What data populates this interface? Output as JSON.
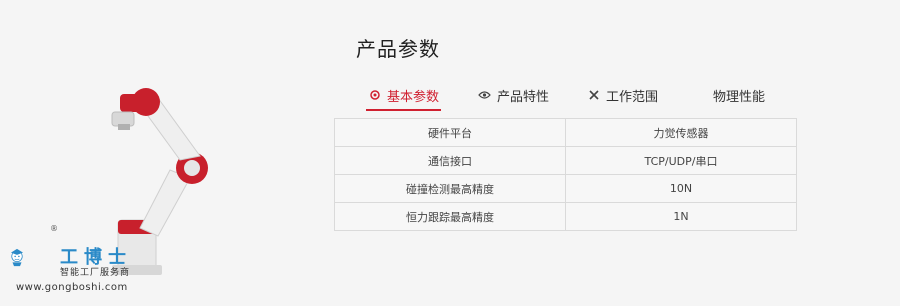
{
  "section": {
    "title": "产品参数"
  },
  "tabs": [
    {
      "label": "基本参数",
      "icon": "gear-icon",
      "active": true
    },
    {
      "label": "产品特性",
      "icon": "eye-icon",
      "active": false
    },
    {
      "label": "工作范围",
      "icon": "tools-icon",
      "active": false
    },
    {
      "label": "物理性能",
      "icon": "",
      "active": false
    }
  ],
  "table": {
    "rows": [
      {
        "name": "硬件平台",
        "value": "力觉传感器"
      },
      {
        "name": "通信接口",
        "value": "TCP/UDP/串口"
      },
      {
        "name": "碰撞检测最高精度",
        "value": "10N"
      },
      {
        "name": "恒力跟踪最高精度",
        "value": "1N"
      }
    ]
  },
  "watermark": {
    "brand": "工博士",
    "tagline": "智能工厂服务商",
    "url": "www.gongboshi.com",
    "registered": "®"
  },
  "colors": {
    "accent": "#d02030",
    "robot_red": "#c8202c",
    "logo_blue": "#2a8ac8"
  }
}
